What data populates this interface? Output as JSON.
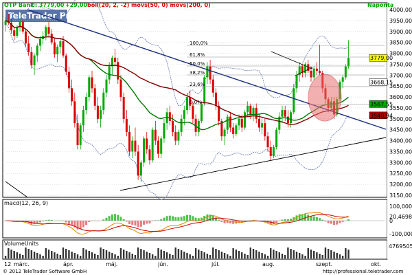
{
  "header": {
    "symbol": "OTP Bank",
    "last": "C: 3779,00",
    "change": "+29,00",
    "studies": "boll(20, 2, -2) movs(50, 0) movs(200, 0)",
    "period": "Napontа"
  },
  "watermark": "TeleTrader Professional",
  "macd_panel": {
    "title": "macd(12, 26, 9)",
    "ticks": [
      "100,0000",
      "20,4698",
      "0",
      "-100,0000"
    ]
  },
  "volume_panel": {
    "title": "VolumeUnits",
    "ticks": [
      "4769505"
    ]
  },
  "footer": {
    "copyright": "© 2012 TeleTrader Software GmbH",
    "url": "http://professional.teletrader.com"
  },
  "fib_levels": [
    "100,0%",
    "61,8%",
    "50,0%",
    "38,2%",
    "23,6%",
    "0,0%"
  ],
  "price_markers": [
    {
      "value": "3779,00",
      "color": "#ffff00"
    },
    {
      "value": "3668,15",
      "color": "#ffffff"
    },
    {
      "value": "3567,55",
      "color": "#00aa00"
    },
    {
      "value": "3540,94",
      "color": "#aa0000"
    }
  ],
  "colors": {
    "up": "#00aa00",
    "down": "#dd0000",
    "bg": "#ffffff",
    "panel_title": "#2255aa"
  },
  "chart_data": {
    "type": "candlestick",
    "x_tick_labels": [
      "12",
      "márc.",
      "ápr.",
      "máj.",
      "jún.",
      "júl.",
      "aug.",
      "szept.",
      "okt."
    ],
    "y_tick_labels": [
      "4000,00",
      "3950,00",
      "3900,00",
      "3850,00",
      "3800,00",
      "3750,00",
      "3700,00",
      "3650,00",
      "3600,00",
      "3550,00",
      "3500,00",
      "3450,00",
      "3400,00",
      "3350,00",
      "3300,00",
      "3250,00",
      "3200,00",
      "3150,00"
    ],
    "ylim": [
      3150,
      4000
    ],
    "candles": [
      [
        3930,
        3965,
        3900,
        3950
      ],
      [
        3950,
        3980,
        3930,
        3940
      ],
      [
        3940,
        3960,
        3890,
        3905
      ],
      [
        3905,
        3920,
        3860,
        3880
      ],
      [
        3880,
        3930,
        3870,
        3920
      ],
      [
        3920,
        3960,
        3900,
        3945
      ],
      [
        3945,
        3955,
        3890,
        3900
      ],
      [
        3900,
        3910,
        3830,
        3845
      ],
      [
        3845,
        3880,
        3790,
        3805
      ],
      [
        3805,
        3830,
        3730,
        3745
      ],
      [
        3745,
        3800,
        3700,
        3790
      ],
      [
        3790,
        3845,
        3760,
        3835
      ],
      [
        3835,
        3880,
        3810,
        3865
      ],
      [
        3865,
        3900,
        3840,
        3880
      ],
      [
        3880,
        3930,
        3860,
        3920
      ],
      [
        3920,
        3945,
        3880,
        3890
      ],
      [
        3890,
        3910,
        3840,
        3850
      ],
      [
        3850,
        3870,
        3780,
        3795
      ],
      [
        3795,
        3840,
        3760,
        3830
      ],
      [
        3830,
        3870,
        3800,
        3855
      ],
      [
        3855,
        3880,
        3780,
        3790
      ],
      [
        3790,
        3800,
        3700,
        3715
      ],
      [
        3715,
        3740,
        3620,
        3640
      ],
      [
        3640,
        3680,
        3560,
        3580
      ],
      [
        3580,
        3620,
        3460,
        3480
      ],
      [
        3480,
        3520,
        3360,
        3380
      ],
      [
        3380,
        3480,
        3360,
        3470
      ],
      [
        3470,
        3560,
        3440,
        3540
      ],
      [
        3540,
        3620,
        3520,
        3600
      ],
      [
        3600,
        3700,
        3580,
        3690
      ],
      [
        3690,
        3720,
        3620,
        3640
      ],
      [
        3640,
        3660,
        3540,
        3560
      ],
      [
        3560,
        3600,
        3480,
        3500
      ],
      [
        3500,
        3560,
        3460,
        3540
      ],
      [
        3540,
        3640,
        3520,
        3620
      ],
      [
        3620,
        3700,
        3600,
        3680
      ],
      [
        3680,
        3760,
        3660,
        3740
      ],
      [
        3740,
        3790,
        3700,
        3780
      ],
      [
        3780,
        3820,
        3740,
        3760
      ],
      [
        3760,
        3780,
        3660,
        3680
      ],
      [
        3680,
        3700,
        3580,
        3600
      ],
      [
        3600,
        3620,
        3480,
        3500
      ],
      [
        3500,
        3540,
        3420,
        3440
      ],
      [
        3440,
        3470,
        3330,
        3350
      ],
      [
        3350,
        3420,
        3320,
        3400
      ],
      [
        3400,
        3460,
        3330,
        3350
      ],
      [
        3350,
        3380,
        3220,
        3240
      ],
      [
        3240,
        3310,
        3210,
        3300
      ],
      [
        3300,
        3420,
        3280,
        3410
      ],
      [
        3410,
        3440,
        3340,
        3360
      ],
      [
        3360,
        3380,
        3290,
        3310
      ],
      [
        3310,
        3460,
        3300,
        3450
      ],
      [
        3450,
        3490,
        3380,
        3400
      ],
      [
        3400,
        3420,
        3320,
        3340
      ],
      [
        3340,
        3420,
        3320,
        3410
      ],
      [
        3410,
        3500,
        3390,
        3480
      ],
      [
        3480,
        3550,
        3450,
        3530
      ],
      [
        3530,
        3560,
        3470,
        3490
      ],
      [
        3490,
        3520,
        3420,
        3440
      ],
      [
        3440,
        3470,
        3380,
        3400
      ],
      [
        3400,
        3450,
        3380,
        3440
      ],
      [
        3440,
        3520,
        3420,
        3500
      ],
      [
        3500,
        3560,
        3470,
        3540
      ],
      [
        3540,
        3620,
        3520,
        3600
      ],
      [
        3600,
        3630,
        3540,
        3560
      ],
      [
        3560,
        3580,
        3480,
        3500
      ],
      [
        3500,
        3520,
        3420,
        3440
      ],
      [
        3440,
        3500,
        3420,
        3490
      ],
      [
        3490,
        3580,
        3480,
        3570
      ],
      [
        3570,
        3700,
        3560,
        3690
      ],
      [
        3690,
        3760,
        3660,
        3740
      ],
      [
        3740,
        3770,
        3660,
        3680
      ],
      [
        3680,
        3700,
        3600,
        3620
      ],
      [
        3620,
        3640,
        3540,
        3560
      ],
      [
        3560,
        3580,
        3470,
        3490
      ],
      [
        3490,
        3500,
        3400,
        3420
      ],
      [
        3420,
        3460,
        3380,
        3450
      ],
      [
        3450,
        3520,
        3430,
        3510
      ],
      [
        3510,
        3530,
        3440,
        3460
      ],
      [
        3460,
        3480,
        3410,
        3430
      ],
      [
        3430,
        3480,
        3420,
        3470
      ],
      [
        3470,
        3520,
        3450,
        3500
      ],
      [
        3500,
        3520,
        3440,
        3460
      ],
      [
        3460,
        3540,
        3450,
        3530
      ],
      [
        3530,
        3580,
        3510,
        3560
      ],
      [
        3560,
        3570,
        3500,
        3520
      ],
      [
        3520,
        3560,
        3490,
        3550
      ],
      [
        3550,
        3570,
        3480,
        3500
      ],
      [
        3500,
        3520,
        3440,
        3460
      ],
      [
        3460,
        3500,
        3430,
        3480
      ],
      [
        3480,
        3500,
        3400,
        3420
      ],
      [
        3420,
        3440,
        3350,
        3370
      ],
      [
        3370,
        3400,
        3310,
        3330
      ],
      [
        3330,
        3380,
        3320,
        3370
      ],
      [
        3370,
        3460,
        3360,
        3450
      ],
      [
        3450,
        3530,
        3430,
        3510
      ],
      [
        3510,
        3560,
        3480,
        3540
      ],
      [
        3540,
        3560,
        3490,
        3510
      ],
      [
        3510,
        3540,
        3460,
        3480
      ],
      [
        3480,
        3540,
        3460,
        3530
      ],
      [
        3530,
        3660,
        3520,
        3640
      ],
      [
        3640,
        3720,
        3620,
        3700
      ],
      [
        3700,
        3760,
        3670,
        3740
      ],
      [
        3740,
        3750,
        3690,
        3710
      ],
      [
        3710,
        3760,
        3690,
        3750
      ],
      [
        3750,
        3770,
        3710,
        3720
      ],
      [
        3720,
        3740,
        3670,
        3690
      ],
      [
        3690,
        3740,
        3680,
        3730
      ],
      [
        3730,
        3760,
        3700,
        3720
      ],
      [
        3720,
        3840,
        3700,
        3710
      ],
      [
        3710,
        3720,
        3620,
        3640
      ],
      [
        3640,
        3660,
        3570,
        3590
      ],
      [
        3590,
        3600,
        3530,
        3550
      ],
      [
        3550,
        3600,
        3540,
        3580
      ],
      [
        3580,
        3600,
        3500,
        3520
      ],
      [
        3520,
        3600,
        3510,
        3590
      ],
      [
        3590,
        3680,
        3580,
        3670
      ],
      [
        3670,
        3700,
        3640,
        3690
      ],
      [
        3690,
        3750,
        3680,
        3740
      ],
      [
        3740,
        3860,
        3730,
        3779
      ]
    ]
  }
}
